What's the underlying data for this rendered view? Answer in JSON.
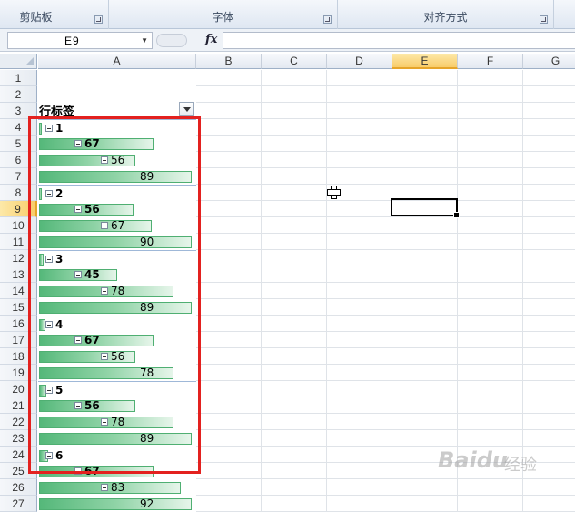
{
  "ribbon": {
    "groups": [
      {
        "label": "剪贴板"
      },
      {
        "label": "字体"
      },
      {
        "label": "对齐方式"
      }
    ]
  },
  "formula_bar": {
    "name_box": "E9",
    "fx_label": "fx",
    "formula": ""
  },
  "columns": [
    "A",
    "B",
    "C",
    "D",
    "E",
    "F",
    "G"
  ],
  "selected_column": "E",
  "rows": [
    "1",
    "2",
    "3",
    "4",
    "5",
    "6",
    "7",
    "8",
    "9",
    "10",
    "11",
    "12",
    "13",
    "14",
    "15",
    "16",
    "17",
    "18",
    "19",
    "20",
    "21",
    "22",
    "23",
    "24",
    "25",
    "26",
    "27"
  ],
  "selected_row": "9",
  "pivot": {
    "header": "行标签",
    "rows": [
      {
        "label": "1",
        "level": 0,
        "pct": 0.01
      },
      {
        "label": "67",
        "level": 1,
        "pct": 0.75
      },
      {
        "label": "56",
        "level": 2,
        "pct": 0.63
      },
      {
        "label": "89",
        "level": 3,
        "pct": 1.0
      },
      {
        "label": "2",
        "level": 0,
        "pct": 0.02
      },
      {
        "label": "56",
        "level": 1,
        "pct": 0.62
      },
      {
        "label": "67",
        "level": 2,
        "pct": 0.74
      },
      {
        "label": "90",
        "level": 3,
        "pct": 1.0
      },
      {
        "label": "3",
        "level": 0,
        "pct": 0.03
      },
      {
        "label": "45",
        "level": 1,
        "pct": 0.51
      },
      {
        "label": "78",
        "level": 2,
        "pct": 0.88
      },
      {
        "label": "89",
        "level": 3,
        "pct": 1.0
      },
      {
        "label": "4",
        "level": 0,
        "pct": 0.04
      },
      {
        "label": "67",
        "level": 1,
        "pct": 0.75
      },
      {
        "label": "56",
        "level": 2,
        "pct": 0.63
      },
      {
        "label": "78",
        "level": 3,
        "pct": 0.88
      },
      {
        "label": "5",
        "level": 0,
        "pct": 0.05
      },
      {
        "label": "56",
        "level": 1,
        "pct": 0.63
      },
      {
        "label": "78",
        "level": 2,
        "pct": 0.88
      },
      {
        "label": "89",
        "level": 3,
        "pct": 1.0
      },
      {
        "label": "6",
        "level": 0,
        "pct": 0.06
      },
      {
        "label": "67",
        "level": 1,
        "pct": 0.75
      },
      {
        "label": "83",
        "level": 2,
        "pct": 0.93
      },
      {
        "label": "92",
        "level": 3,
        "pct": 1.0
      }
    ]
  },
  "watermark": {
    "text": "Baidu",
    "suffix": "经验"
  }
}
